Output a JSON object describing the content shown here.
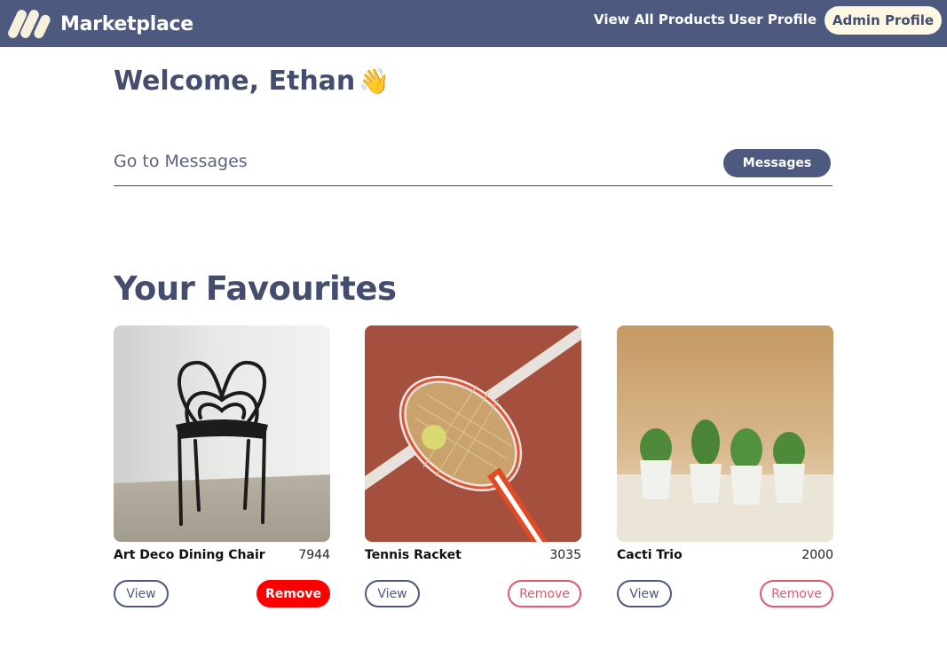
{
  "app": {
    "title": "Marketplace",
    "logo_icon": "marketplace-logo-icon"
  },
  "nav": {
    "view_all_products": "View All Products",
    "user_profile": "User Profile",
    "admin_profile": "Admin Profile"
  },
  "welcome": {
    "text": "Welcome, Ethan",
    "emoji": "👋"
  },
  "messages": {
    "label": "Go to Messages",
    "button": "Messages"
  },
  "favourites": {
    "title": "Your Favourites",
    "items": [
      {
        "name": "Art Deco Dining Chair",
        "price": "7944",
        "image": "chair-photo",
        "view_label": "View",
        "remove_label": "Remove",
        "remove_active": true
      },
      {
        "name": "Tennis Racket",
        "price": "3035",
        "image": "tennis-racket-photo",
        "view_label": "View",
        "remove_label": "Remove",
        "remove_active": false
      },
      {
        "name": "Cacti Trio",
        "price": "2000",
        "image": "cacti-photo",
        "view_label": "View",
        "remove_label": "Remove",
        "remove_active": false
      }
    ]
  },
  "colors": {
    "navbar": "#4e5980",
    "admin_button_bg": "#fdf7e6",
    "remove_active": "#fe0000",
    "remove_outline": "#e5596a",
    "heading": "#454d6e"
  }
}
